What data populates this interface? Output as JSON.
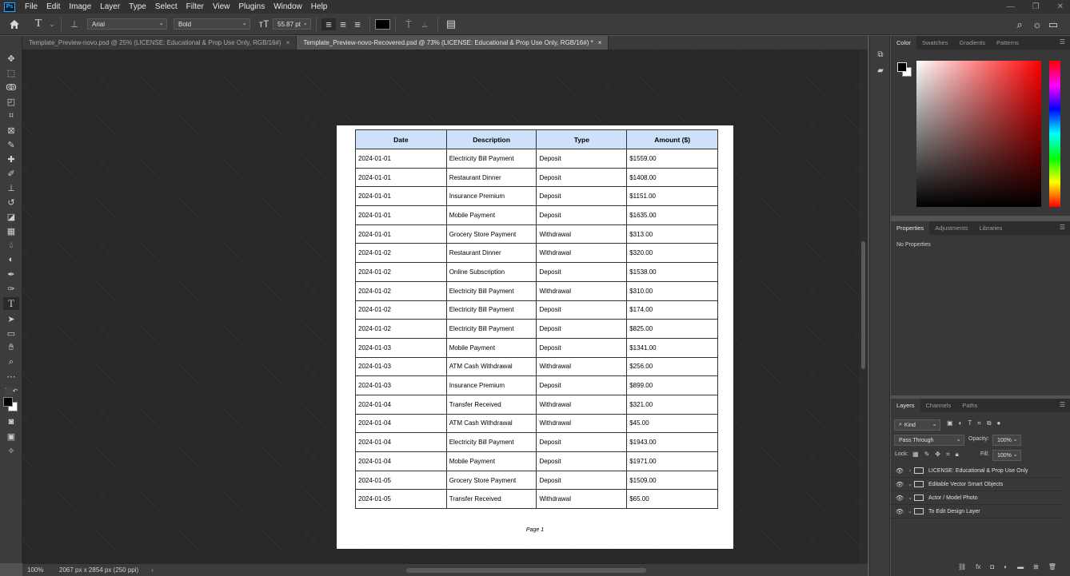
{
  "menubar": {
    "app_logo": "Ps",
    "items": [
      "File",
      "Edit",
      "Image",
      "Layer",
      "Type",
      "Select",
      "Filter",
      "View",
      "Plugins",
      "Window",
      "Help"
    ]
  },
  "options": {
    "font_family": "Arial",
    "font_style": "Bold",
    "font_size": "55.87 pt",
    "text_color": "#000000"
  },
  "tabs": [
    {
      "label": "Template_Preview-novo.psd @ 25% (LICENSE: Educational & Prop Use Only, RGB/16#)",
      "close": "×"
    },
    {
      "label": "Template_Preview-novo-Recovered.psd @ 73% (LICENSE: Educational & Prop Use Only, RGB/16#) *",
      "close": "×"
    }
  ],
  "document": {
    "headers": [
      "Date",
      "Description",
      "Type",
      "Amount ($)"
    ],
    "header_color": "#cfe0fb",
    "rows": [
      [
        "2024-01-01",
        "Electricity Bill Payment",
        "Deposit",
        "$1559.00"
      ],
      [
        "2024-01-01",
        "Restaurant Dinner",
        "Deposit",
        "$1408.00"
      ],
      [
        "2024-01-01",
        "Insurance Premium",
        "Deposit",
        "$1151.00"
      ],
      [
        "2024-01-01",
        "Mobile Payment",
        "Deposit",
        "$1635.00"
      ],
      [
        "2024-01-01",
        "Grocery Store Payment",
        "Withdrawal",
        "$313.00"
      ],
      [
        "2024-01-02",
        "Restaurant Dinner",
        "Withdrawal",
        "$320.00"
      ],
      [
        "2024-01-02",
        "Online Subscription",
        "Deposit",
        "$1538.00"
      ],
      [
        "2024-01-02",
        "Electricity Bill Payment",
        "Withdrawal",
        "$310.00"
      ],
      [
        "2024-01-02",
        "Electricity Bill Payment",
        "Deposit",
        "$174.00"
      ],
      [
        "2024-01-02",
        "Electricity Bill Payment",
        "Deposit",
        "$825.00"
      ],
      [
        "2024-01-03",
        "Mobile Payment",
        "Deposit",
        "$1341.00"
      ],
      [
        "2024-01-03",
        "ATM Cash Withdrawal",
        "Withdrawal",
        "$256.00"
      ],
      [
        "2024-01-03",
        "Insurance Premium",
        "Deposit",
        "$899.00"
      ],
      [
        "2024-01-04",
        "Transfer Received",
        "Withdrawal",
        "$321.00"
      ],
      [
        "2024-01-04",
        "ATM Cash Withdrawal",
        "Withdrawal",
        "$45.00"
      ],
      [
        "2024-01-04",
        "Electricity Bill Payment",
        "Deposit",
        "$1943.00"
      ],
      [
        "2024-01-04",
        "Mobile Payment",
        "Deposit",
        "$1971.00"
      ],
      [
        "2024-01-05",
        "Grocery Store Payment",
        "Deposit",
        "$1509.00"
      ],
      [
        "2024-01-05",
        "Transfer Received",
        "Withdrawal",
        "$65.00"
      ]
    ],
    "page_label": "Page 1"
  },
  "status": {
    "zoom": "100%",
    "doc_info": "2067 px x 2854 px (250 ppi)"
  },
  "color_panel": {
    "tabs": [
      "Color",
      "Swatches",
      "Gradients",
      "Patterns"
    ],
    "hue_color": "#ff0000"
  },
  "properties_panel": {
    "tabs": [
      "Properties",
      "Adjustments",
      "Libraries"
    ],
    "empty_text": "No Properties"
  },
  "layers_panel": {
    "tabs": [
      "Layers",
      "Channels",
      "Paths"
    ],
    "kind_filter": "Kind",
    "blend_mode": "Pass Through",
    "opacity_label": "Opacity:",
    "opacity_value": "100%",
    "lock_label": "Lock:",
    "fill_label": "Fill:",
    "fill_value": "100%",
    "layers": [
      {
        "name": "LICENSE: Educational & Prop Use Only",
        "arrow": "›"
      },
      {
        "name": "Editable Vector Smart Objects",
        "arrow": "⌄"
      },
      {
        "name": "Actor / Model Photo",
        "arrow": "⌄"
      },
      {
        "name": "To Edit Design Layer",
        "arrow": "⌄"
      }
    ]
  }
}
